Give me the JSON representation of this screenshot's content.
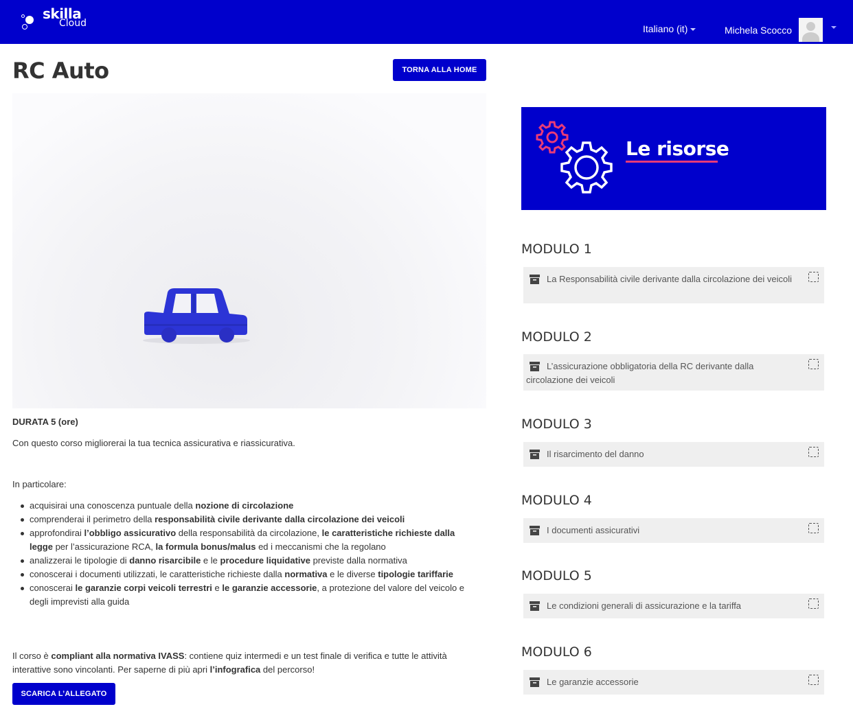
{
  "header": {
    "brand_line1": "skilla",
    "brand_line2": "Cloud",
    "language": "Italiano (it)",
    "user_name": "Michela Scocco"
  },
  "course": {
    "title": "RC Auto",
    "home_button": "TORNA ALLA HOME",
    "duration": "DURATA 5 (ore)",
    "intro": "Con questo corso migliorerai la tua tecnica assicurativa e riassicurativa.",
    "particular": "In particolare:",
    "bullets": [
      [
        {
          "t": "acquisirai una conoscenza puntuale della "
        },
        {
          "t": "nozione di circolazione",
          "b": true
        }
      ],
      [
        {
          "t": "comprenderai il perimetro della "
        },
        {
          "t": "responsabilità civile derivante dalla circolazione dei veicoli",
          "b": true
        }
      ],
      [
        {
          "t": "approfondirai "
        },
        {
          "t": "l’obbligo assicurativo",
          "b": true
        },
        {
          "t": " della responsabilità da circolazione, "
        },
        {
          "t": "le caratteristiche richieste dalla legge",
          "b": true
        },
        {
          "t": " per l’assicurazione RCA, "
        },
        {
          "t": "la formula bonus/malus",
          "b": true
        },
        {
          "t": " ed i meccanismi che la regolano"
        }
      ],
      [
        {
          "t": "analizzerai le tipologie di "
        },
        {
          "t": "danno risarcibile",
          "b": true
        },
        {
          "t": " e le "
        },
        {
          "t": "procedure liquidative",
          "b": true
        },
        {
          "t": " previste dalla normativa"
        }
      ],
      [
        {
          "t": "conoscerai i documenti utilizzati, le caratteristiche richieste dalla "
        },
        {
          "t": "normativa",
          "b": true
        },
        {
          "t": " e le diverse "
        },
        {
          "t": "tipologie tariffarie",
          "b": true
        }
      ],
      [
        {
          "t": "conoscerai "
        },
        {
          "t": "le garanzie corpi veicoli terrestri",
          "b": true
        },
        {
          "t": " e "
        },
        {
          "t": "le garanzie accessorie",
          "b": true
        },
        {
          "t": ", a protezione del valore del veicolo e degli imprevisti alla guida"
        }
      ]
    ],
    "compliant": [
      {
        "t": "Il corso è "
      },
      {
        "t": "compliant alla normativa IVASS",
        "b": true
      },
      {
        "t": ": contiene quiz intermedi e un test finale di verifica e tutte le attività interattive sono vincolanti. Per saperne di più apri "
      },
      {
        "t": "l’infografica",
        "b": true
      },
      {
        "t": " del percorso!"
      }
    ],
    "download_button": "SCARICA L’ALLEGATO"
  },
  "resources": {
    "banner_title": "Le risorse",
    "colors": {
      "brand": "#0000cc",
      "accent": "#e83b78"
    },
    "modules": [
      {
        "heading": "MODULO 1",
        "activity": "La Responsabilità civile derivante dalla circolazione dei veicoli"
      },
      {
        "heading": "MODULO 2",
        "activity": "L’assicurazione obbligatoria della RC derivante dalla circolazione dei veicoli"
      },
      {
        "heading": "MODULO 3",
        "activity": "Il risarcimento del danno"
      },
      {
        "heading": "MODULO 4",
        "activity": "I documenti assicurativi"
      },
      {
        "heading": "MODULO 5",
        "activity": "Le condizioni generali di assicurazione e la tariffa"
      },
      {
        "heading": "MODULO 6",
        "activity": "Le garanzie accessorie"
      }
    ]
  }
}
